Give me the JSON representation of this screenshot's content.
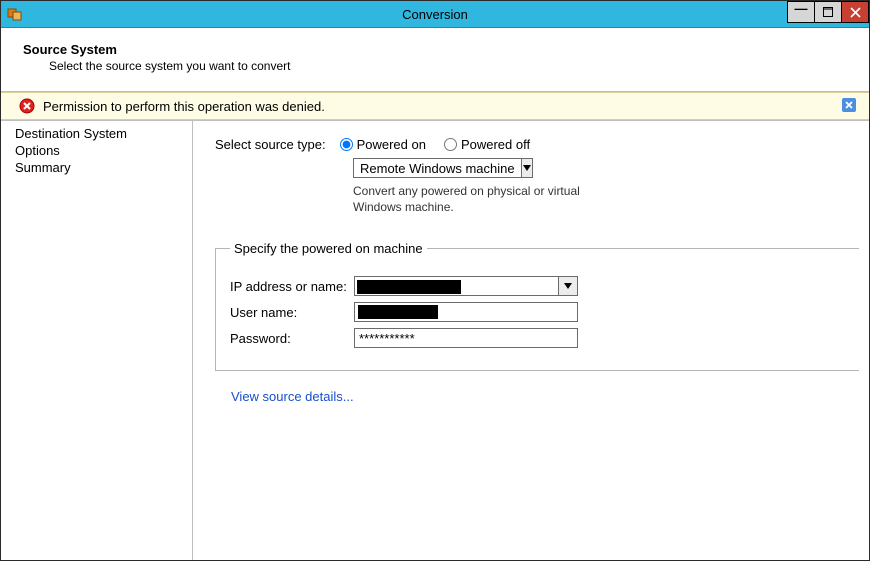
{
  "window": {
    "title": "Conversion"
  },
  "header": {
    "title": "Source System",
    "subtitle": "Select the source system you want to convert"
  },
  "error": {
    "message": "Permission to perform this operation was denied."
  },
  "sidebar": {
    "items": [
      {
        "label": "Destination System"
      },
      {
        "label": "Options"
      },
      {
        "label": "Summary"
      }
    ]
  },
  "main": {
    "source_type_label": "Select source type:",
    "radio_on": "Powered on",
    "radio_off": "Powered off",
    "source_type_value": "Remote Windows machine",
    "hint_line1": "Convert any powered on physical or virtual",
    "hint_line2": "Windows machine.",
    "fieldset_legend": "Specify the powered on machine",
    "ip_label": "IP address or name:",
    "user_label": "User name:",
    "password_label": "Password:",
    "password_value": "***********",
    "view_details_label": "View source details..."
  }
}
